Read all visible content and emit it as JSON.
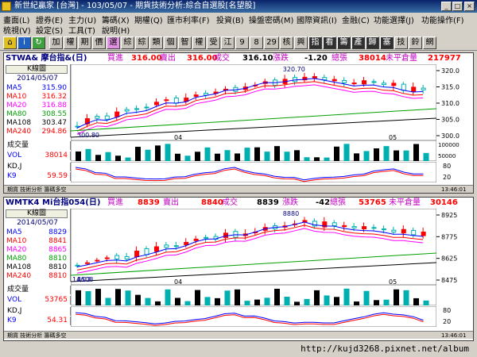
{
  "window": {
    "title": "新世紀贏家 [台灣] - 103/05/07 - 期貨技術分析:綜合自選股[名望股]",
    "min_label": "_",
    "max_label": "□",
    "close_label": "×"
  },
  "menu_row1": [
    "畫面(L)",
    "證券(E)",
    "主力(U)",
    "籌碼(X)",
    "期權(Q)",
    "匯市利率(F)",
    "投資(B)",
    "操盤密碼(M)",
    "國際資訊(I)",
    "金融(C)",
    "功能選擇(J)",
    "功能操作(F)"
  ],
  "menu_row2": [
    "梳視(V)",
    "設定(S)",
    "工具(T)",
    "說明(H)"
  ],
  "toolbar": [
    "加",
    "權",
    "期",
    "價",
    "選",
    "綜",
    "綜",
    "類",
    "個",
    "智",
    "權",
    "受",
    "江",
    "9",
    "8",
    "29",
    "核",
    "興",
    "指",
    "看",
    "籌",
    "產",
    "歸",
    "塞",
    "技",
    "鈴",
    "網"
  ],
  "panel1": {
    "symbol": "STWA& 摩台指&(日)",
    "bid_label": "買進",
    "bid": "316.00",
    "ask_label": "賣出",
    "ask": "316.00",
    "trade_label": "成交",
    "trade": "316.10",
    "chg_label": "漲跌",
    "chg": "-1.20",
    "vol_label": "總張",
    "vol": "38014",
    "oi_label": "未平倉量",
    "oi": "217977",
    "kbtn": "K線圖",
    "date": "2014/05/07",
    "ma": [
      {
        "name": "MA5",
        "value": "315.90",
        "color": "#0000ff"
      },
      {
        "name": "MA10",
        "value": "316.32",
        "color": "#ff0000"
      },
      {
        "name": "MA20",
        "value": "316.88",
        "color": "#ff00ff"
      },
      {
        "name": "MA80",
        "value": "308.55",
        "color": "#00a000"
      },
      {
        "name": "MA108",
        "value": "303.47",
        "color": "#000000"
      },
      {
        "name": "MA240",
        "value": "294.86",
        "color": "#ff0000"
      }
    ],
    "high_label": "320.70",
    "low_label": "300.80",
    "yticks": [
      "320.0",
      "315.0",
      "310.0",
      "305.0",
      "300.0"
    ],
    "xticks": [
      "04",
      "05"
    ],
    "vol_title": "成交量",
    "vol_name": "VOL",
    "vol_value": "38014",
    "vol_ticks": [
      "100000",
      "50000"
    ],
    "kd_title": "KD,J",
    "k_name": "K9",
    "k_value": "59.59",
    "kd_ticks": [
      "80",
      "20"
    ],
    "status_left": "期貨  技術分析  籌碼多空",
    "status_right": "13:46:01"
  },
  "panel2": {
    "symbol": "WMTK4 Mi台指054(日)",
    "bid_label": "買進",
    "bid": "8839",
    "ask_label": "賣出",
    "ask": "8840",
    "trade_label": "成交",
    "trade": "8839",
    "chg_label": "漲跌",
    "chg": "-42",
    "vol_label": "總張",
    "vol": "53765",
    "oi_label": "未平倉量",
    "oi": "30146",
    "kbtn": "K線圖",
    "date": "2014/05/07",
    "ma": [
      {
        "name": "MA5",
        "value": "8829",
        "color": "#0000ff"
      },
      {
        "name": "MA10",
        "value": "8841",
        "color": "#ff0000"
      },
      {
        "name": "MA20",
        "value": "8865",
        "color": "#ff00ff"
      },
      {
        "name": "MA80",
        "value": "8810",
        "color": "#00a000"
      },
      {
        "name": "MA108",
        "value": "8810",
        "color": "#000000"
      },
      {
        "name": "MA240",
        "value": "8810",
        "color": "#ff0000"
      }
    ],
    "high_label": "8880",
    "low_label": "8508",
    "start_date": "14/03",
    "yticks": [
      "8925",
      "8775",
      "8625",
      "8475"
    ],
    "xticks": [
      "04",
      "05"
    ],
    "vol_title": "成交量",
    "vol_name": "VOL",
    "vol_value": "53765",
    "kd_title": "KD,J",
    "k_name": "K9",
    "k_value": "54.31",
    "kd_ticks": [
      "80",
      "20"
    ],
    "status_left": "期貨  技術分析  籌碼多空",
    "status_right": "13:46:01"
  },
  "footer": {
    "url": "http://kujd3268.pixnet.net/album"
  },
  "colors": {
    "up": "#ff0000",
    "down": "#00b0b0",
    "title_bg": "#0a246a"
  }
}
